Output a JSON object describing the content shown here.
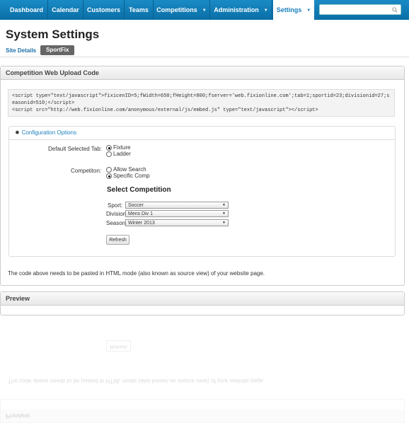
{
  "nav": {
    "items": [
      "Dashboard",
      "Calendar",
      "Customers",
      "Teams",
      "Competitions",
      "Administration",
      "Settings"
    ],
    "search_placeholder": ""
  },
  "page": {
    "title": "System Settings"
  },
  "subtabs": [
    "Site Details",
    "SportFix"
  ],
  "upload": {
    "heading": "Competition Web Upload Code",
    "code": "<script type=\"text/javascript\">fixicenID=5;fWidth=650;fHeight=800;fserver='web.fixionline.com';tab=1;sportid=23;divisionid=27;seasonid=510;</script>\n<script src=\"http://web.fixionline.com/anonymous/external/js/embed.js\" type=\"text/javascript\"></script>",
    "config_title": "Configuration Options",
    "default_tab_label": "Default Selected Tab:",
    "tab_options": [
      "Fixture",
      "Ladder"
    ],
    "competition_label": "Competiton:",
    "competition_options": [
      "Allow Search",
      "Specific Comp"
    ],
    "select_heading": "Select Competition",
    "sport_label": "Sport:",
    "sport_value": "Soccer",
    "division_label": "Division:",
    "division_value": "Mens Div 1",
    "season_label": "Season:",
    "season_value": "Winter 2013",
    "refresh_label": "Refresh",
    "note": "The code above needs to be pasted in HTML mode (also known as source view) of your website page."
  },
  "preview": {
    "heading": "Preview"
  }
}
